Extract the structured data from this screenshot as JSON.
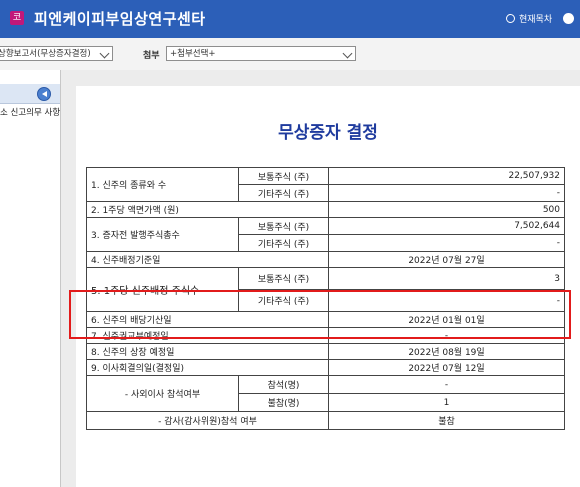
{
  "header": {
    "logo_text": "코",
    "company": "피엔케이피부임상연구센타",
    "current_toc": "현재목차"
  },
  "toolbar": {
    "report_select": "상향보고서(무상증자결정)",
    "attach_label": "첨부",
    "attach_select": "+첨부선택+"
  },
  "sidebar": {
    "item": "소 신고의무 사항"
  },
  "document": {
    "title": "무상증자 결정",
    "rows": {
      "r1_label": "1. 신주의 종류와 수",
      "common": "보통주식 (주)",
      "other": "기타주식 (주)",
      "r1_common": "22,507,932",
      "r1_other": "-",
      "r2_label": "2. 1주당 액면가액 (원)",
      "r2_value": "500",
      "r3_label": "3. 증자전 발행주식총수",
      "r3_common": "7,502,644",
      "r3_other": "-",
      "r4_label": "4. 신주배정기준일",
      "r4_value": "2022년 07월 27일",
      "r5_label": "5. 1주당 신주배정 주식수",
      "r5_common": "3",
      "r5_other": "-",
      "r6_label": "6. 신주의 배당기산일",
      "r6_value": "2022년 01월 01일",
      "r7_label": "7. 신주권교부예정일",
      "r7_value": "-",
      "r8_label": "8. 신주의 상장 예정일",
      "r8_value": "2022년 08월 19일",
      "r9_label": "9. 이사회결의일(결정일)",
      "r9_value": "2022년 07월 12일",
      "r10_label": "- 사외이사 참석여부",
      "attend": "참석(명)",
      "absent": "불참(명)",
      "r10_attend": "-",
      "r10_absent": "1",
      "r11_label": "- 감사(감사위원)참석 여부",
      "r11_value": "불참"
    }
  },
  "colors": {
    "topbar": "#2c5fb8",
    "title": "#1f3b9e",
    "highlight": "#e21b1b"
  }
}
